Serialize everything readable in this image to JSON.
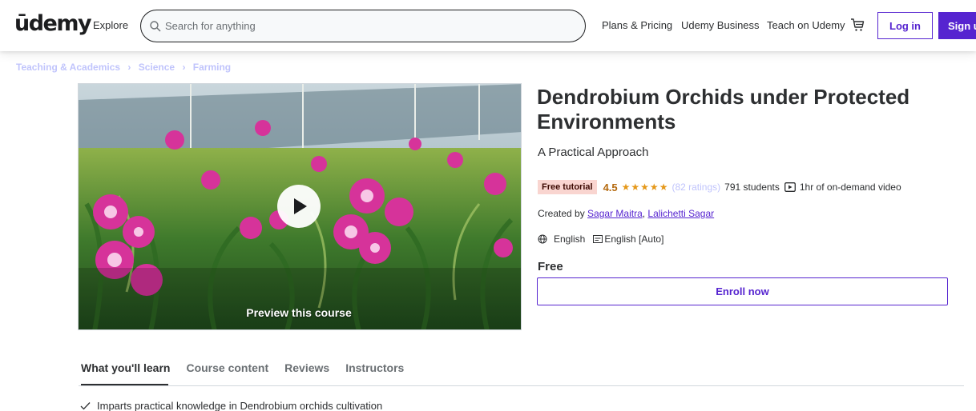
{
  "header": {
    "logo": "ūdemy",
    "explore": "Explore",
    "search_placeholder": "Search for anything",
    "plans": "Plans & Pricing",
    "business": "Udemy Business",
    "teach": "Teach on Udemy",
    "login": "Log in",
    "signup": "Sign up",
    "icons": [
      "search-icon",
      "cart-icon"
    ]
  },
  "breadcrumb": [
    "Teaching & Academics",
    "Science",
    "Farming"
  ],
  "video": {
    "preview_label": "Preview this course",
    "icon": "play-icon"
  },
  "course": {
    "title": "Dendrobium Orchids under Protected Environments",
    "subtitle": "A Practical Approach",
    "badge": "Free tutorial",
    "rating": "4.5",
    "stars": "★★★★★",
    "ratings_count": "(82 ratings)",
    "students": "791 students",
    "video_length": "1hr of on-demand video",
    "created_by_label": "Created by",
    "instructors": [
      "Sagar Maitra",
      "Lalichetti Sagar"
    ],
    "instructor_sep": ", ",
    "language": "English",
    "captions": "English [Auto]",
    "price": "Free",
    "enroll": "Enroll now"
  },
  "tabs": [
    "What you'll learn",
    "Course content",
    "Reviews",
    "Instructors"
  ],
  "learn": [
    "Imparts practical knowledge in Dendrobium orchids cultivation"
  ],
  "colors": {
    "brand": "#5624d0",
    "rating": "#b4690e",
    "star": "#e59819",
    "badge_bg": "#f9d5d0"
  }
}
